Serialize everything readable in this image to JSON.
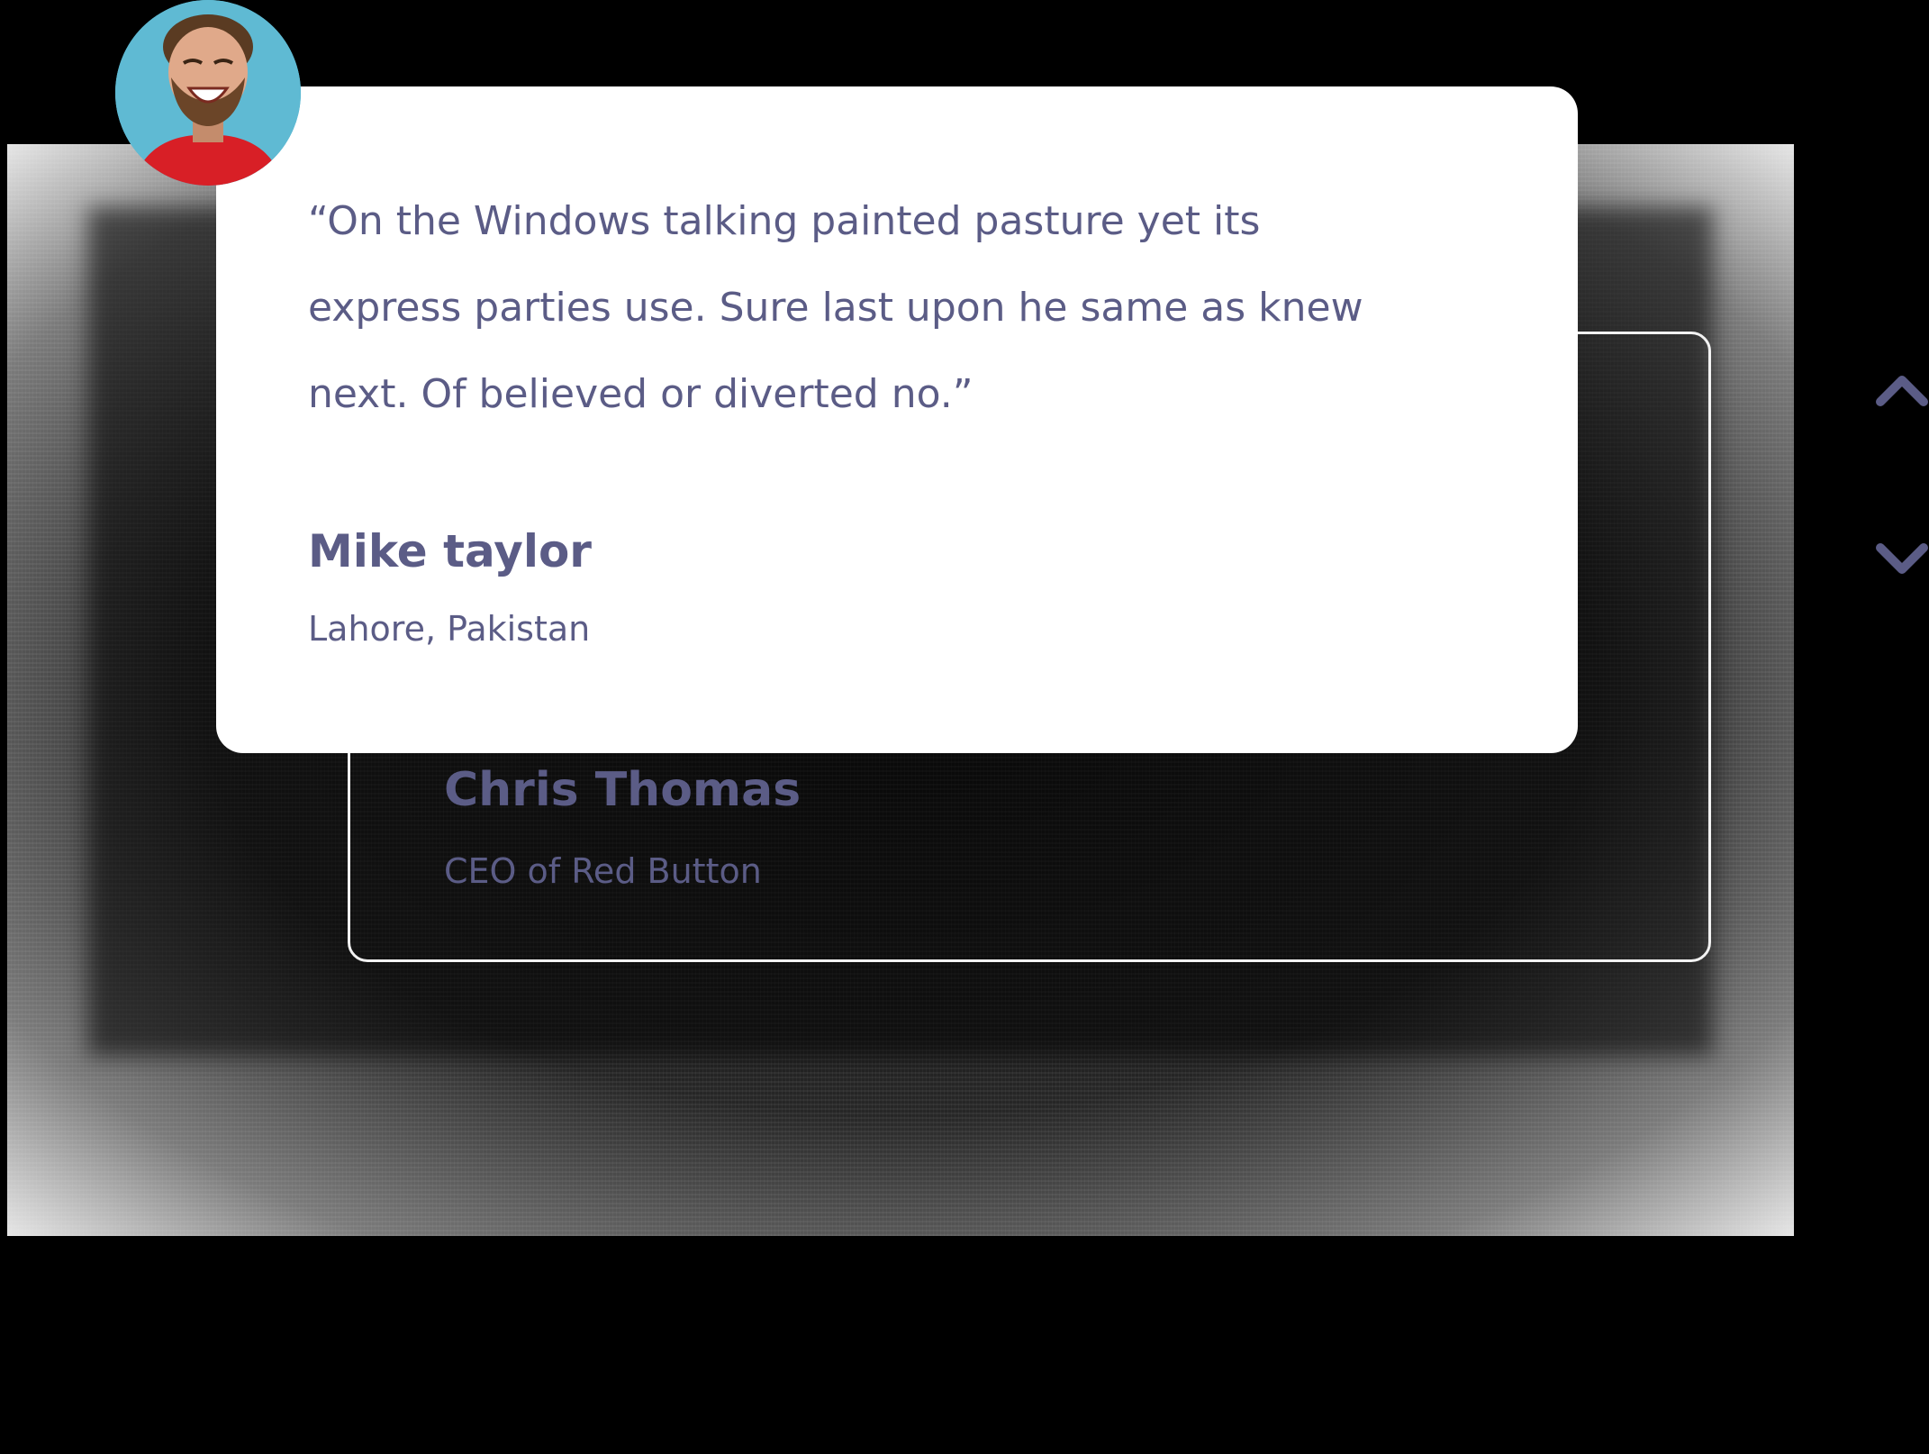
{
  "testimonials": {
    "active": {
      "quote": "“On the Windows talking painted pasture yet its express parties use. Sure last upon he same as knew next. Of believed or diverted no.”",
      "name": "Mike taylor",
      "location": "Lahore, Pakistan",
      "avatar_icon": "person-avatar-photo"
    },
    "next": {
      "name": "Chris Thomas",
      "role": "CEO of Red Button"
    }
  },
  "navigation": {
    "previous_icon": "chevron-up-icon",
    "next_icon": "chevron-down-icon"
  },
  "colors": {
    "text": "#5b5c86",
    "card_background": "#ffffff",
    "page_background": "#000000",
    "avatar_background": "#58b5cf",
    "avatar_shirt": "#d81f26"
  }
}
